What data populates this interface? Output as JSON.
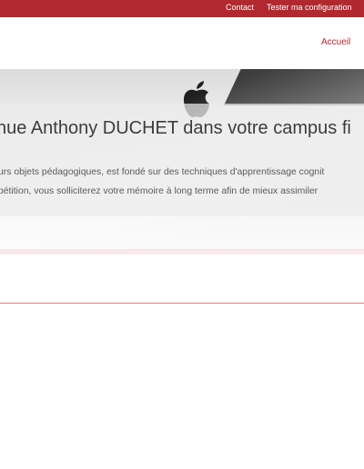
{
  "topbar": {
    "links": {
      "contact": "Contact",
      "config": "Tester ma configuration"
    },
    "color": "#b2282f"
  },
  "nav": {
    "home": "Accueil"
  },
  "hero": {
    "title": "nue Anthony DUCHET dans votre campus fi",
    "line1": "urs objets pédagogiques, est fondé sur des techniques d'apprentissage cognit",
    "line2": "pétition, vous solliciterez votre mémoire à long terme afin de mieux assimiler",
    "image_icon": "apple-logo-icon"
  }
}
